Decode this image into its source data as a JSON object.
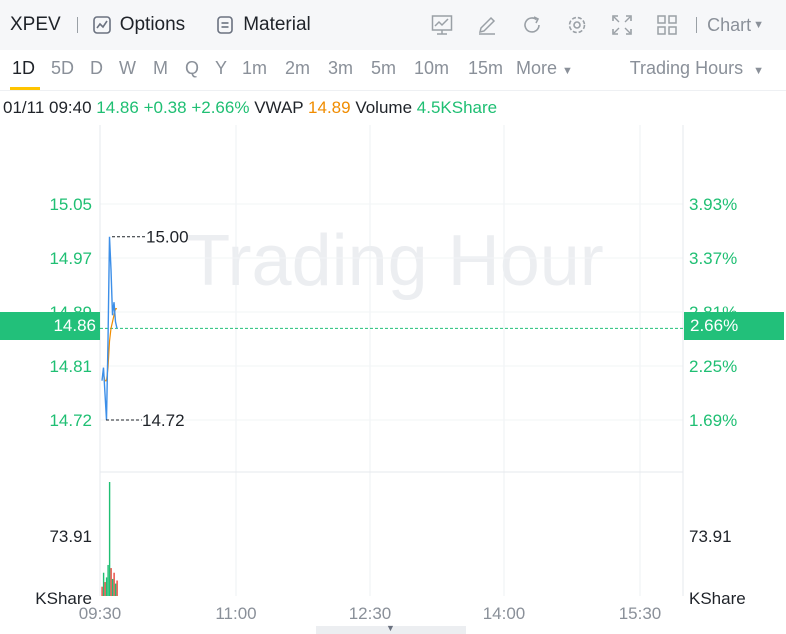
{
  "toolbar": {
    "ticker": "XPEV",
    "options_label": "Options",
    "material_label": "Material",
    "chart_menu_label": "Chart"
  },
  "periods": {
    "items": [
      "1D",
      "5D",
      "D",
      "W",
      "M",
      "Q",
      "Y",
      "1m",
      "2m",
      "3m",
      "5m",
      "10m",
      "15m",
      "More"
    ],
    "active": "1D",
    "trading_hours_label": "Trading Hours"
  },
  "info": {
    "datetime": "01/11 09:40",
    "price": "14.86",
    "change": "+0.38",
    "change_pct": "+2.66%",
    "vwap_label": "VWAP",
    "vwap": "14.89",
    "volume_label": "Volume",
    "volume": "4.5KShare"
  },
  "colors": {
    "up": "#1fbf73",
    "vwap": "#f08c00",
    "price_line": "#3d8fe8",
    "current": "#22c07a"
  },
  "chart_data": {
    "type": "line",
    "watermark": "Trading Hour",
    "x_ticks": [
      "09:30",
      "11:00",
      "12:30",
      "14:00",
      "15:30"
    ],
    "y_left_ticks": [
      "15.05",
      "14.97",
      "14.89",
      "14.81",
      "14.72"
    ],
    "y_right_ticks": [
      "3.93%",
      "3.37%",
      "2.81%",
      "2.25%",
      "1.69%"
    ],
    "current_price": "14.86",
    "current_pct": "2.66%",
    "high_label": "15.00",
    "low_label": "14.72",
    "volume_axis_label": "73.91",
    "volume_unit": "KShare",
    "ylim": [
      14.67,
      15.12
    ],
    "price_series": {
      "name": "Price",
      "x": [
        "09:30",
        "09:31",
        "09:32",
        "09:33",
        "09:34",
        "09:35",
        "09:36",
        "09:37",
        "09:38",
        "09:39",
        "09:40"
      ],
      "values": [
        14.78,
        14.8,
        14.76,
        14.72,
        14.84,
        15.0,
        14.95,
        14.88,
        14.9,
        14.87,
        14.86
      ]
    },
    "vwap_series": {
      "name": "VWAP",
      "x": [
        "09:30",
        "09:31",
        "09:32",
        "09:33",
        "09:34",
        "09:35",
        "09:36",
        "09:37",
        "09:38",
        "09:39",
        "09:40"
      ],
      "values": [
        14.79,
        14.79,
        14.78,
        14.78,
        14.8,
        14.84,
        14.86,
        14.87,
        14.88,
        14.89,
        14.89
      ]
    },
    "volume_series": {
      "values": [
        12,
        30,
        18,
        24,
        40,
        147,
        36,
        22,
        30,
        16,
        20
      ],
      "colors": [
        "#e8453c",
        "#1fbf73",
        "#e8453c",
        "#1fbf73",
        "#1fbf73",
        "#1fbf73",
        "#e8453c",
        "#1fbf73",
        "#e8453c",
        "#1fbf73",
        "#e8453c"
      ]
    }
  }
}
